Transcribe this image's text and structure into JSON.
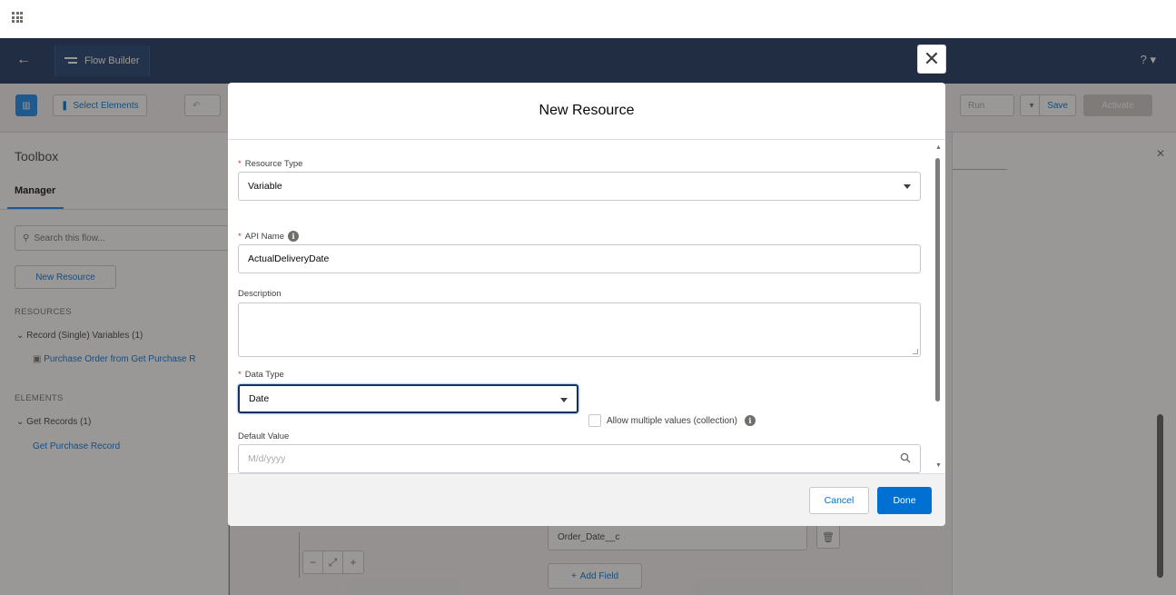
{
  "header": {
    "back_label": "←",
    "app_name": "Flow Builder",
    "help_label": "? ▾"
  },
  "toolbar": {
    "select_elements": "Select Elements",
    "run": "Run",
    "save": "Save",
    "activate": "Activate"
  },
  "toolbox": {
    "title": "Toolbox",
    "tab_manager": "Manager",
    "search_placeholder": "Search this flow...",
    "new_resource_button": "New Resource",
    "resources_heading": "RESOURCES",
    "record_variables": "Record (Single) Variables (1)",
    "record_item": "Purchase Order from Get Purchase R",
    "elements_heading": "ELEMENTS",
    "get_records": "Get Records (1)",
    "get_records_item": "Get Purchase Record"
  },
  "right_panel": {
    "field_value": "Order_Date__c",
    "add_field": "Add Field"
  },
  "modal": {
    "title": "New Resource",
    "resource_type_label": "Resource Type",
    "resource_type_value": "Variable",
    "api_name_label": "API Name",
    "api_name_value": "ActualDeliveryDate",
    "description_label": "Description",
    "data_type_label": "Data Type",
    "data_type_value": "Date",
    "allow_multiple_label": "Allow multiple values (collection)",
    "default_value_label": "Default Value",
    "default_value_placeholder": "M/d/yyyy",
    "cancel": "Cancel",
    "done": "Done",
    "required_mark": "*"
  },
  "colors": {
    "header_navy": "#16325c",
    "brand_blue": "#0070d2"
  }
}
